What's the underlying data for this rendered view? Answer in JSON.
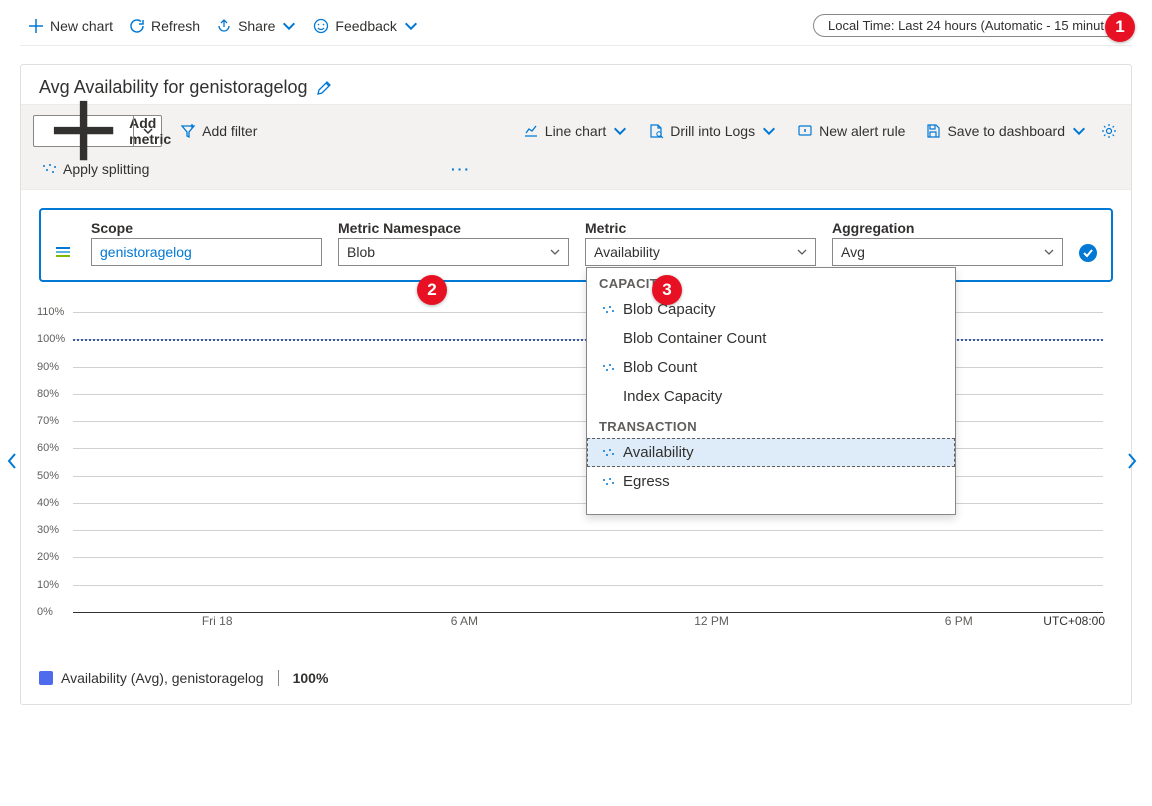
{
  "top_toolbar": {
    "new_chart": "New chart",
    "refresh": "Refresh",
    "share": "Share",
    "feedback": "Feedback",
    "time_range": "Local Time: Last 24 hours (Automatic - 15 minut…"
  },
  "callouts": {
    "c1": "1",
    "c2": "2",
    "c3": "3"
  },
  "card": {
    "title": "Avg Availability for genistoragelog",
    "add_metric": "Add metric",
    "add_filter": "Add filter",
    "line_chart": "Line chart",
    "drill_logs": "Drill into Logs",
    "new_alert": "New alert rule",
    "save_dash": "Save to dashboard",
    "apply_splitting": "Apply splitting"
  },
  "selector": {
    "scope_label": "Scope",
    "scope_value": "genistoragelog",
    "ns_label": "Metric Namespace",
    "ns_value": "Blob",
    "metric_label": "Metric",
    "metric_value": "Availability",
    "agg_label": "Aggregation",
    "agg_value": "Avg"
  },
  "dropdown": {
    "group_capacity": "CAPACITY",
    "cap1": "Blob Capacity",
    "cap2": "Blob Container Count",
    "cap3": "Blob Count",
    "cap4": "Index Capacity",
    "group_transaction": "TRANSACTION",
    "tr1": "Availability",
    "tr2": "Egress"
  },
  "legend": {
    "text": "Availability (Avg), genistoragelog",
    "value": "100%"
  },
  "chart_data": {
    "type": "line",
    "title": "Avg Availability for genistoragelog",
    "x": [
      "Fri 18",
      "6 AM",
      "12 PM",
      "6 PM"
    ],
    "series": [
      {
        "name": "Availability (Avg), genistoragelog",
        "value_constant": 100
      }
    ],
    "ylabel": "%",
    "ylim": [
      0,
      110
    ],
    "yticks": [
      "0%",
      "10%",
      "20%",
      "30%",
      "40%",
      "50%",
      "60%",
      "70%",
      "80%",
      "90%",
      "100%",
      "110%"
    ],
    "xticks": [
      "Fri 18",
      "6 AM",
      "12 PM",
      "6 PM"
    ],
    "timezone": "UTC+08:00"
  }
}
